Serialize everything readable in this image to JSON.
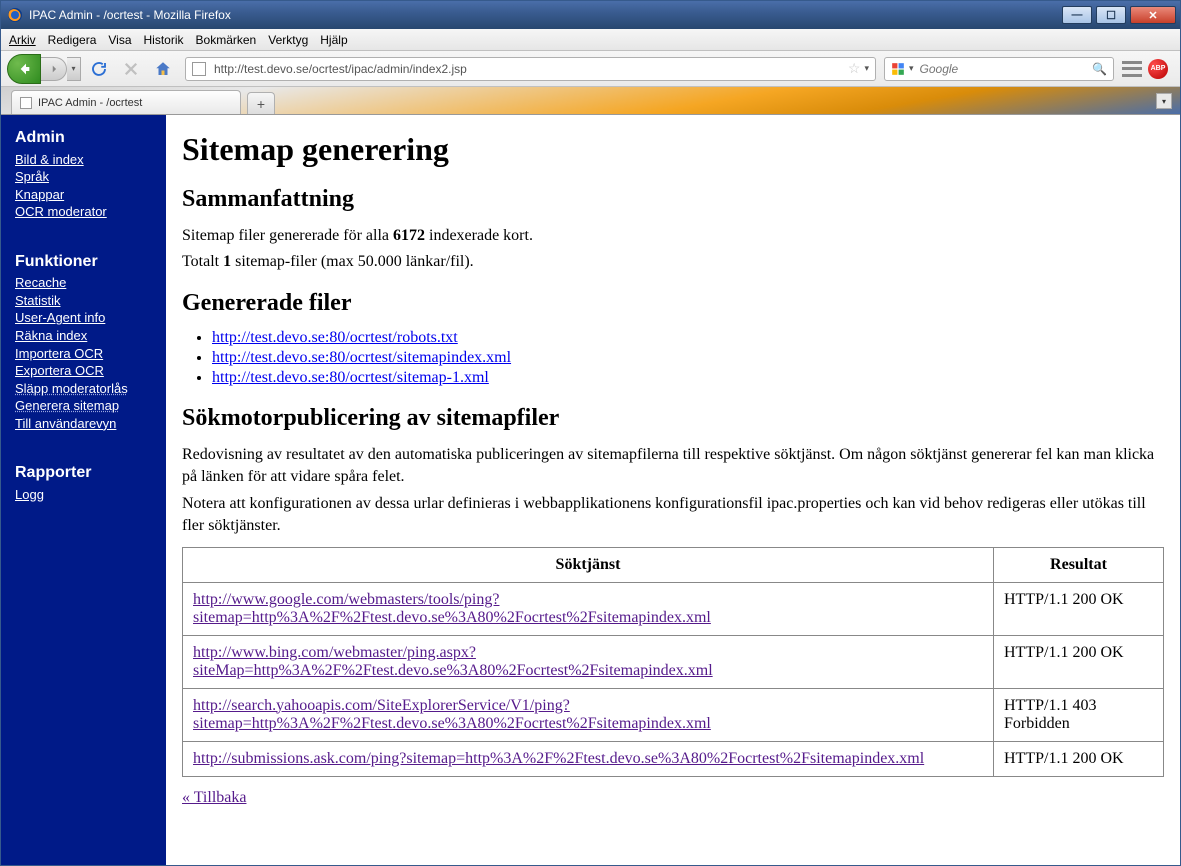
{
  "window": {
    "title": "IPAC Admin - /ocrtest - Mozilla Firefox"
  },
  "menubar": [
    "Arkiv",
    "Redigera",
    "Visa",
    "Historik",
    "Bokmärken",
    "Verktyg",
    "Hjälp"
  ],
  "url": "http://test.devo.se/ocrtest/ipac/admin/index2.jsp",
  "search_placeholder": "Google",
  "tab_title": "IPAC Admin - /ocrtest",
  "sidebar": {
    "admin_heading": "Admin",
    "admin_links": [
      "Bild & index",
      "Språk",
      "Knappar",
      "OCR moderator"
    ],
    "func_heading": "Funktioner",
    "func_links": [
      "Recache",
      "Statistik",
      "User-Agent info",
      "Räkna index",
      "Importera OCR",
      "Exportera OCR",
      "Släpp moderatorlås",
      "Generera sitemap",
      "Till användarevyn"
    ],
    "report_heading": "Rapporter",
    "report_links": [
      "Logg"
    ]
  },
  "page": {
    "h1": "Sitemap generering",
    "h2_summary": "Sammanfattning",
    "summary_line1a": "Sitemap filer genererade för alla ",
    "summary_bold": "6172",
    "summary_line1b": " indexerade kort.",
    "summary_line2a": "Totalt ",
    "summary_line2_bold": "1",
    "summary_line2b": " sitemap-filer (max 50.000 länkar/fil).",
    "h2_files": "Genererade filer",
    "files": [
      "http://test.devo.se:80/ocrtest/robots.txt",
      "http://test.devo.se:80/ocrtest/sitemapindex.xml",
      "http://test.devo.se:80/ocrtest/sitemap-1.xml"
    ],
    "h2_publish": "Sökmotorpublicering av sitemapfiler",
    "publish_p1": "Redovisning av resultatet av den automatiska publiceringen av sitemapfilerna till respektive söktjänst. Om någon söktjänst genererar fel kan man klicka på länken för att vidare spåra felet.",
    "publish_p2": "Notera att konfigurationen av dessa urlar definieras i webbapplikationens konfigurationsfil ipac.properties och kan vid behov redigeras eller utökas till fler söktjänster.",
    "table": {
      "col1": "Söktjänst",
      "col2": "Resultat",
      "rows": [
        {
          "url": "http://www.google.com/webmasters/tools/ping?sitemap=http%3A%2F%2Ftest.devo.se%3A80%2Focrtest%2Fsitemapindex.xml",
          "result": "HTTP/1.1 200 OK"
        },
        {
          "url": "http://www.bing.com/webmaster/ping.aspx?siteMap=http%3A%2F%2Ftest.devo.se%3A80%2Focrtest%2Fsitemapindex.xml",
          "result": "HTTP/1.1 200 OK"
        },
        {
          "url": "http://search.yahooapis.com/SiteExplorerService/V1/ping?sitemap=http%3A%2F%2Ftest.devo.se%3A80%2Focrtest%2Fsitemapindex.xml",
          "result": "HTTP/1.1 403 Forbidden"
        },
        {
          "url": "http://submissions.ask.com/ping?sitemap=http%3A%2F%2Ftest.devo.se%3A80%2Focrtest%2Fsitemapindex.xml",
          "result": "HTTP/1.1 200 OK"
        }
      ]
    },
    "back": "« Tillbaka"
  }
}
